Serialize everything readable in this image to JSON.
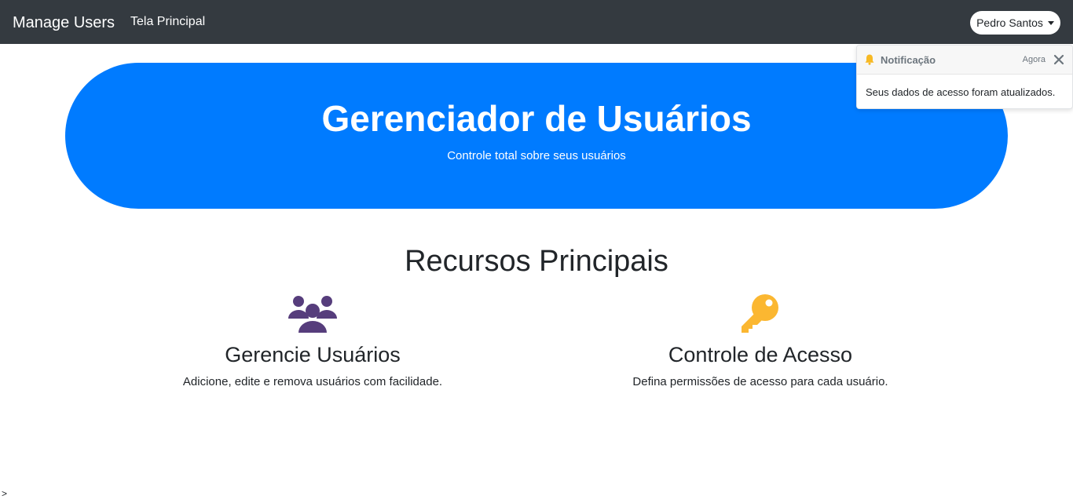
{
  "navbar": {
    "brand": "Manage Users",
    "link": "Tela Principal",
    "user_name": "Pedro Santos",
    "background": "#343a40"
  },
  "hero": {
    "title": "Gerenciador de Usuários",
    "subtitle": "Controle total sobre seus usuários",
    "background": "#007bff"
  },
  "features": {
    "title": "Recursos Principais",
    "items": [
      {
        "icon": "users-icon",
        "icon_color": "#563d7c",
        "title": "Gerencie Usuários",
        "description": "Adicione, edite e remova usuários com facilidade."
      },
      {
        "icon": "key-icon",
        "icon_color": "#fbb731",
        "title": "Controle de Acesso",
        "description": "Defina permissões de acesso para cada usuário."
      }
    ]
  },
  "toast": {
    "icon": "bell-icon",
    "icon_color": "#f7b924",
    "title": "Notificação",
    "time": "Agora",
    "message": "Seus dados de acesso foram atualizados."
  },
  "stray_text": ">"
}
